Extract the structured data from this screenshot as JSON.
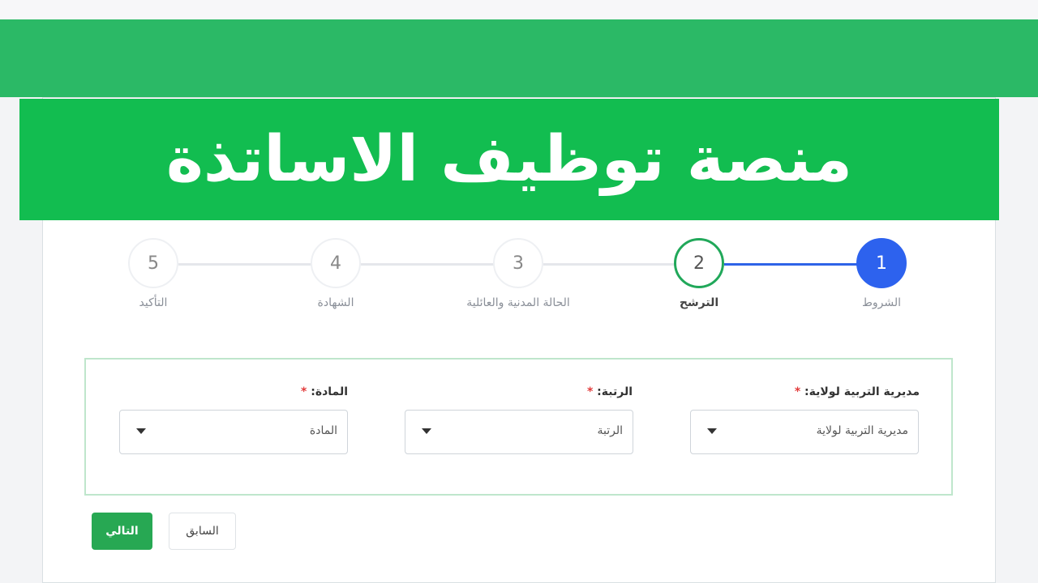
{
  "banner": {
    "title": "منصة توظيف الاساتذة"
  },
  "steps": [
    {
      "number": "1",
      "label": "الشروط",
      "state": "done"
    },
    {
      "number": "2",
      "label": "الترشح",
      "state": "current"
    },
    {
      "number": "3",
      "label": "الحالة المدنية والعائلية",
      "state": "pending"
    },
    {
      "number": "4",
      "label": "الشهادة",
      "state": "pending"
    },
    {
      "number": "5",
      "label": "التأكيد",
      "state": "pending"
    }
  ],
  "form": {
    "fields": [
      {
        "label": "مديرية التربية لولاية:",
        "required": "*",
        "selected": "مديرية التربية لولاية"
      },
      {
        "label": "الرتبة:",
        "required": "*",
        "selected": "الرتبة"
      },
      {
        "label": "المادة:",
        "required": "*",
        "selected": "المادة"
      }
    ]
  },
  "actions": {
    "next_label": "التالي",
    "prev_label": "السابق"
  },
  "colors": {
    "brand_green": "#12bd50",
    "active_blue": "#2d62ee",
    "required_red": "#e23b3b"
  }
}
